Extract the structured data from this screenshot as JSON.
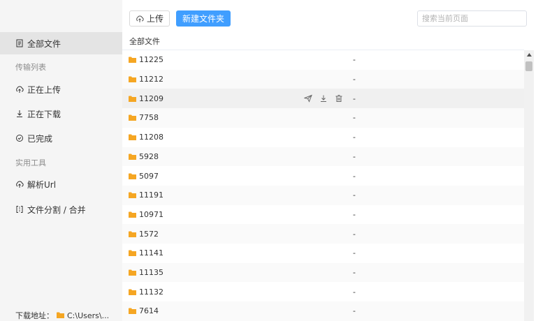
{
  "toolbar": {
    "upload_label": "上传",
    "new_folder_label": "新建文件夹",
    "search_placeholder": "搜索当前页面"
  },
  "sidebar": {
    "all_files": "全部文件",
    "transfer_section": "传输列表",
    "uploading": "正在上传",
    "downloading": "正在下载",
    "completed": "已完成",
    "tools_section": "实用工具",
    "parse_url": "解析Url",
    "split_merge": "文件分割 / 合并",
    "download_path_label": "下载地址：",
    "download_path_value": "C:\\Users\\..."
  },
  "list": {
    "header": "全部文件",
    "rows": [
      {
        "name": "11225",
        "size": "-"
      },
      {
        "name": "11212",
        "size": "-"
      },
      {
        "name": "11209",
        "size": "-"
      },
      {
        "name": "7758",
        "size": "-"
      },
      {
        "name": "11208",
        "size": "-"
      },
      {
        "name": "5928",
        "size": "-"
      },
      {
        "name": "5097",
        "size": "-"
      },
      {
        "name": "11191",
        "size": "-"
      },
      {
        "name": "10971",
        "size": "-"
      },
      {
        "name": "1572",
        "size": "-"
      },
      {
        "name": "11141",
        "size": "-"
      },
      {
        "name": "11135",
        "size": "-"
      },
      {
        "name": "11132",
        "size": "-"
      },
      {
        "name": "7614",
        "size": "-"
      }
    ],
    "hovered_row_actions": [
      "share-icon",
      "download-icon",
      "delete-icon"
    ]
  },
  "colors": {
    "primary": "#409eff",
    "folder": "#f5a623",
    "sidebar_bg": "#f5f5f5",
    "active_item_bg": "#e4e4e4"
  }
}
